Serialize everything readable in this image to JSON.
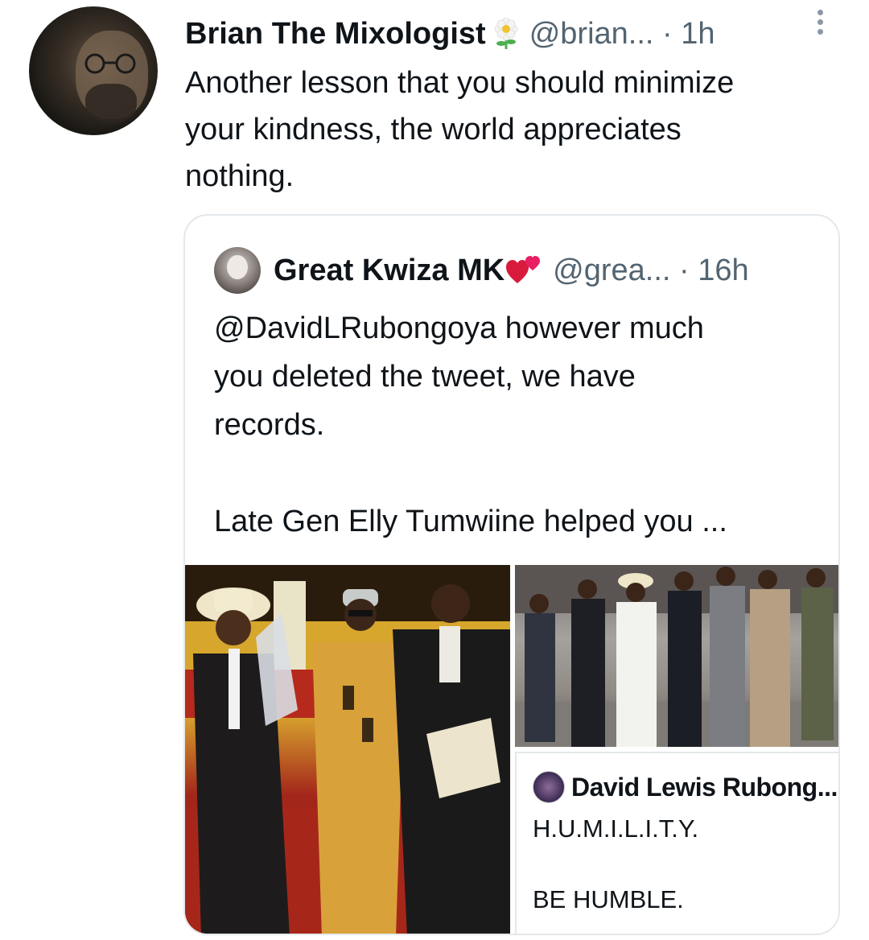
{
  "tweet": {
    "author_name": "Brian The Mixologist",
    "handle": "@brian... · 1h",
    "text": "Another lesson that you should minimize\nyour kindness,  the world appreciates\nnothing."
  },
  "quote": {
    "author_name": "Great Kwiza MK",
    "handle": "@grea...  · 16h",
    "text": "@DavidLRubongoya however much\nyou deleted the tweet, we have\nrecords.\n\nLate Gen Elly Tumwiine helped you ...",
    "embedded": {
      "author_name": "David Lewis Rubong...",
      "text": "H.U.M.I.L.I.T.Y.\n\nBE HUMBLE."
    }
  },
  "icons": {
    "flower": "sunflower-emoji-icon",
    "heart": "two-hearts-emoji-icon",
    "more": "vertical-ellipsis-icon"
  },
  "colors": {
    "text": "#0f1419",
    "muted": "#536471",
    "border": "#e4e8eb"
  }
}
